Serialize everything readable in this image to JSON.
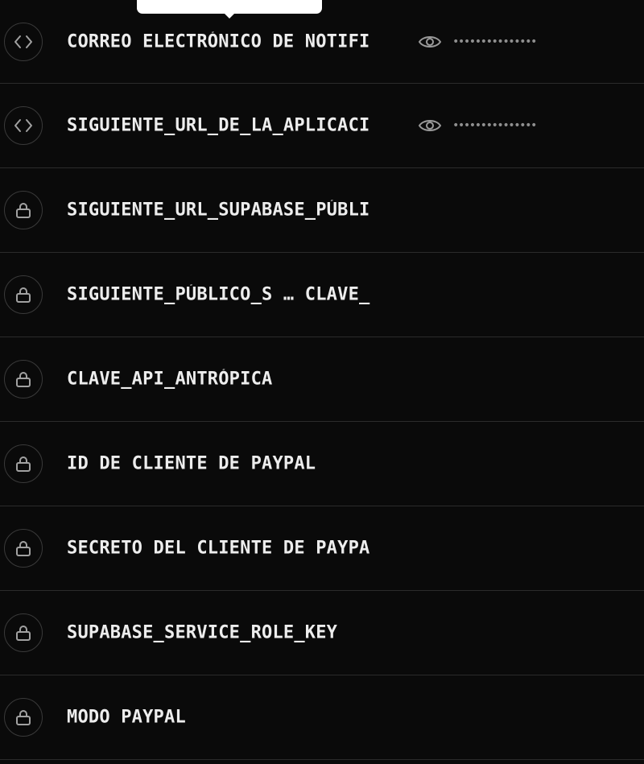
{
  "variables": [
    {
      "name": "CORREO ELECTRÓNICO DE NOTIFI",
      "type_icon": "code-icon",
      "masked_value": "•••••••••••••••",
      "reveal_icon": "eye-icon"
    },
    {
      "name": "SIGUIENTE_URL_DE_LA_APLICACI",
      "type_icon": "code-icon",
      "masked_value": "•••••••••••••••",
      "reveal_icon": "eye-icon"
    },
    {
      "name": "SIGUIENTE_URL_SUPABASE_PÚBLI",
      "type_icon": "lock-icon"
    },
    {
      "name": "SIGUIENTE_PÚBLICO_S … CLAVE_",
      "type_icon": "lock-icon"
    },
    {
      "name": "CLAVE_API_ANTRÓPICA",
      "type_icon": "lock-icon"
    },
    {
      "name": "ID DE CLIENTE DE PAYPAL",
      "type_icon": "lock-icon"
    },
    {
      "name": "SECRETO DEL CLIENTE DE PAYPA",
      "type_icon": "lock-icon"
    },
    {
      "name": "SUPABASE_SERVICE_ROLE_KEY",
      "type_icon": "lock-icon"
    },
    {
      "name": "MODO PAYPAL",
      "type_icon": "lock-icon"
    }
  ],
  "colors": {
    "background": "#0a0a0a",
    "text": "#ededed",
    "muted": "#a1a1a1",
    "divider": "#2b2b2b",
    "tooltip": "#ffffff"
  }
}
